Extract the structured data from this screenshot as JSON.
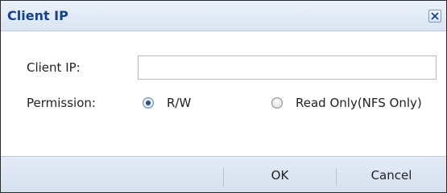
{
  "dialog": {
    "title": "Client IP",
    "close_icon": "close-icon"
  },
  "form": {
    "client_ip_label": "Client IP:",
    "client_ip_value": "",
    "permission_label": "Permission:",
    "permission_options": [
      {
        "label": "R/W",
        "selected": true
      },
      {
        "label": "Read Only(NFS Only)",
        "selected": false
      }
    ]
  },
  "footer": {
    "ok_label": "OK",
    "cancel_label": "Cancel"
  },
  "colors": {
    "title_text": "#15428b",
    "title_bar": "#dae5f3",
    "radio_dot": "#274f85"
  }
}
